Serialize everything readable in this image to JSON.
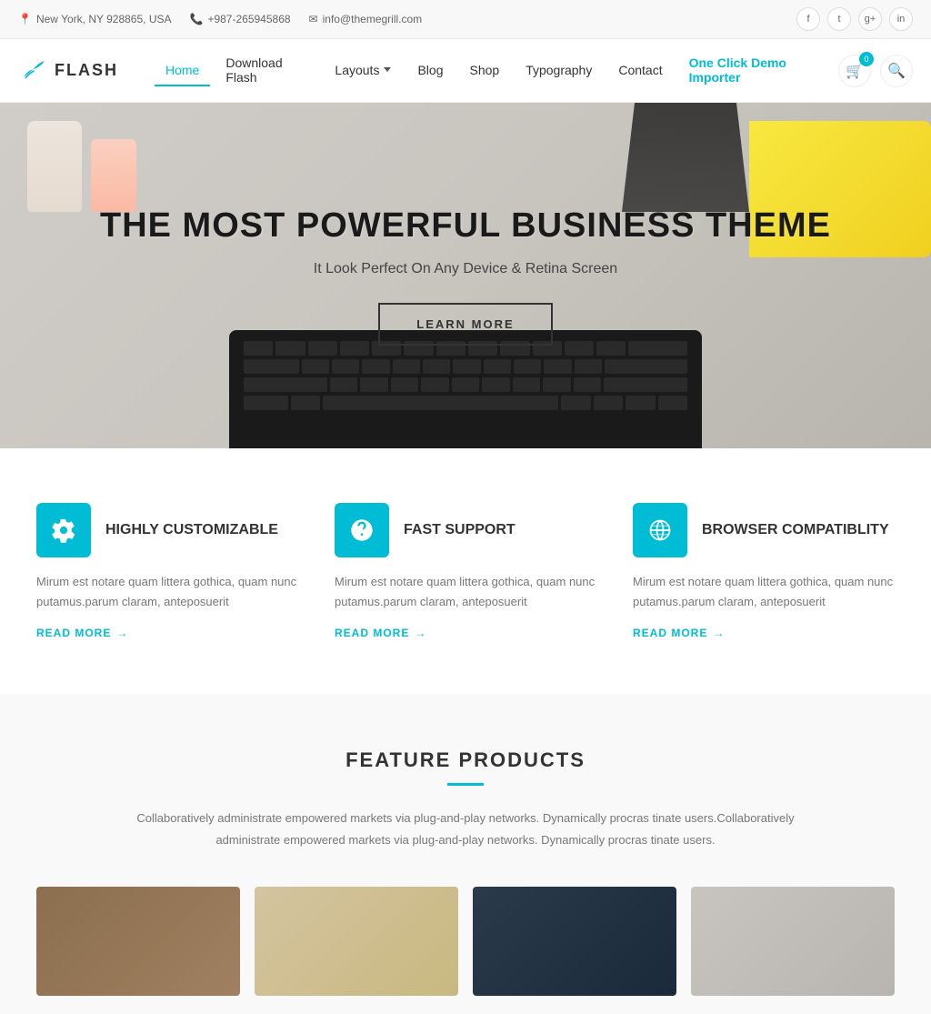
{
  "topbar": {
    "location": "New York, NY 928865, USA",
    "phone": "+987-265945868",
    "email": "info@themegrill.com",
    "socials": [
      "f",
      "t",
      "g+",
      "in"
    ]
  },
  "navbar": {
    "logo_text": "FLASH",
    "nav_items": [
      {
        "label": "Home",
        "active": true,
        "has_dropdown": false
      },
      {
        "label": "Download Flash",
        "active": false,
        "has_dropdown": false
      },
      {
        "label": "Layouts",
        "active": false,
        "has_dropdown": true
      },
      {
        "label": "Blog",
        "active": false,
        "has_dropdown": false
      },
      {
        "label": "Shop",
        "active": false,
        "has_dropdown": false
      },
      {
        "label": "Typography",
        "active": false,
        "has_dropdown": false
      },
      {
        "label": "Contact",
        "active": false,
        "has_dropdown": false
      },
      {
        "label": "One Click Demo Importer",
        "active": false,
        "highlight": true,
        "has_dropdown": false
      }
    ],
    "cart_count": "0"
  },
  "hero": {
    "title": "THE MOST POWERFUL BUSINESS THEME",
    "subtitle": "It Look Perfect On Any Device & Retina Screen",
    "button_label": "LEARN MORE"
  },
  "features": [
    {
      "icon": "⚙",
      "title": "HIGHLY CUSTOMIZABLE",
      "desc": "Mirum est notare quam littera gothica, quam nunc putamus.parum claram, anteposuerit",
      "read_more": "READ MORE"
    },
    {
      "icon": "◎",
      "title": "FAST SUPPORT",
      "desc": "Mirum est notare quam littera gothica, quam nunc putamus.parum claram, anteposuerit",
      "read_more": "READ MORE"
    },
    {
      "icon": "◉",
      "title": "BROWSER COMPATIBLITY",
      "desc": "Mirum est notare quam littera gothica, quam nunc putamus.parum claram, anteposuerit",
      "read_more": "READ MORE"
    }
  ],
  "products_section": {
    "title": "FEATURE PRODUCTS",
    "desc": "Collaboratively administrate empowered markets via plug-and-play networks. Dynamically procras tinate users.Collaboratively administrate empowered markets via plug-and-play networks. Dynamically procras tinate users.",
    "products": [
      {
        "img_class": "product-img-1"
      },
      {
        "img_class": "product-img-2"
      },
      {
        "img_class": "product-img-3"
      },
      {
        "img_class": "product-img-4"
      }
    ]
  }
}
